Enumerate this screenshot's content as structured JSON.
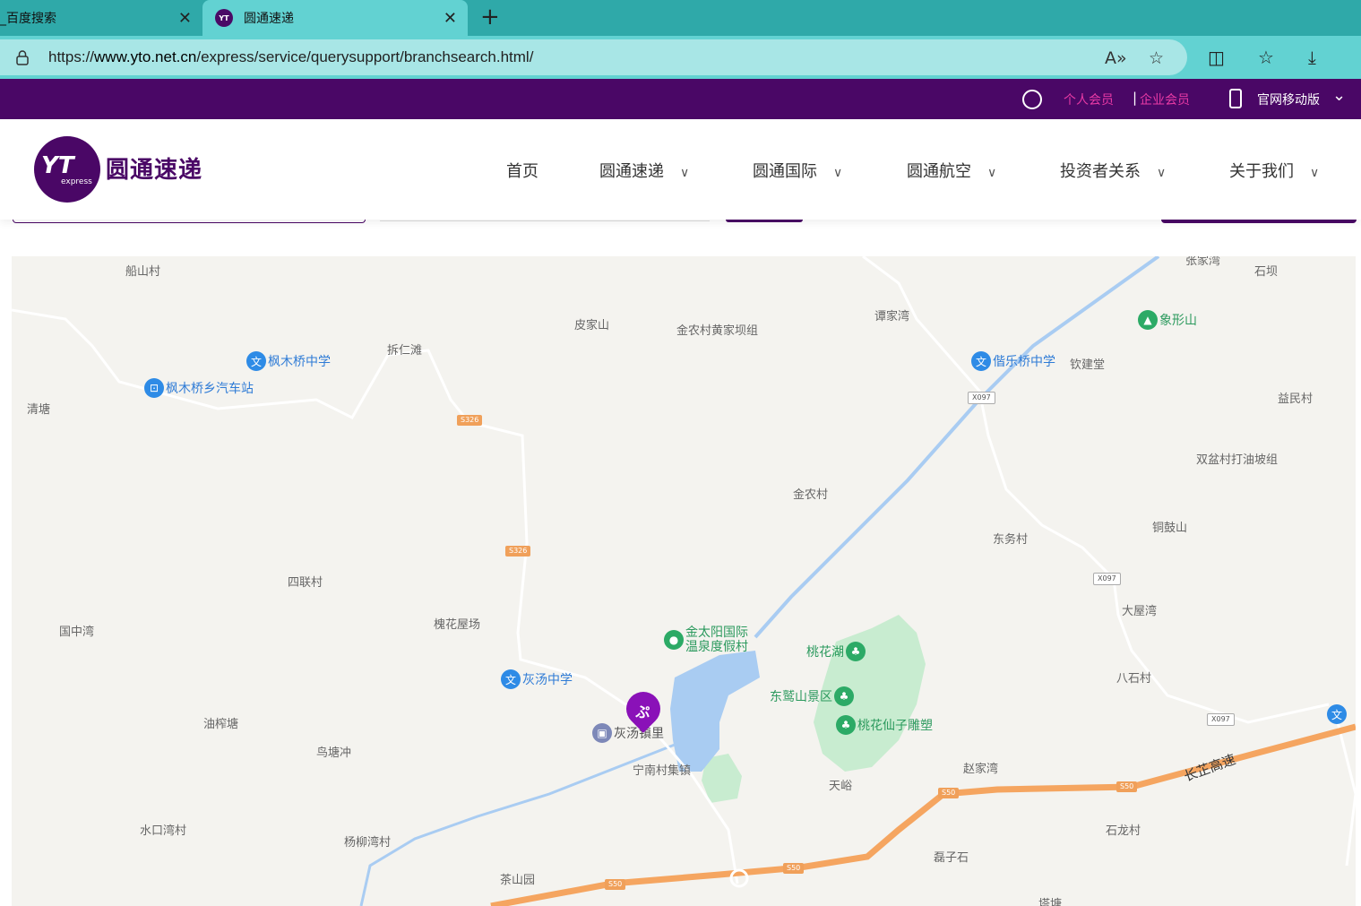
{
  "browser": {
    "tabs": [
      {
        "title": "_百度搜索",
        "active": false
      },
      {
        "title": "圆通速递",
        "active": true
      }
    ],
    "url_prefix": "https://",
    "url_host": "www.yto.net.cn",
    "url_path": "/express/service/querysupport/branchsearch.html/",
    "new_tab_symbol": "+",
    "close_symbol": "✕",
    "colors": {
      "tab_bar": "#2fa9a9",
      "active_tab": "#62d2d2"
    }
  },
  "topbar": {
    "personal": "个人会员",
    "separator": "|",
    "enterprise": "企业会员",
    "mobile": "官网移动版",
    "colors": {
      "bg": "#4a0766",
      "link": "#e83aa5"
    }
  },
  "header": {
    "logo_mark": "YT",
    "logo_sub": "express",
    "logo_text": "圆通速递",
    "nav": [
      {
        "label": "首页",
        "has_menu": false
      },
      {
        "label": "圆通速递",
        "has_menu": true
      },
      {
        "label": "圆通国际",
        "has_menu": true
      },
      {
        "label": "圆通航空",
        "has_menu": true
      },
      {
        "label": "投资者关系",
        "has_menu": true
      },
      {
        "label": "关于我们",
        "has_menu": true
      }
    ]
  },
  "map": {
    "villages": [
      "船山村",
      "皮家山",
      "金农村黄家坝组",
      "谭家湾",
      "张家湾",
      "石坝",
      "拆仁滩",
      "清塘",
      "益民村",
      "双盆村打油坡组",
      "金农村",
      "东务村",
      "铜鼓山",
      "四联村",
      "国中湾",
      "槐花屋场",
      "大屋湾",
      "八石村",
      "油榨塘",
      "鸟塘冲",
      "宁南村集镇",
      "天峪",
      "赵家湾",
      "水口湾村",
      "杨柳湾村",
      "茶山园",
      "石龙村",
      "磊子石",
      "塔塘",
      "钦建堂"
    ],
    "pois": [
      {
        "name": "枫木桥中学",
        "kind": "school"
      },
      {
        "name": "枫木桥乡汽车站",
        "kind": "bus"
      },
      {
        "name": "偕乐桥中学",
        "kind": "school"
      },
      {
        "name": "象形山",
        "kind": "park"
      },
      {
        "name": "金太阳国际温泉度假村",
        "kind": "resort"
      },
      {
        "name": "桃花湖",
        "kind": "park"
      },
      {
        "name": "东鹫山景区",
        "kind": "park"
      },
      {
        "name": "桃花仙子雕塑",
        "kind": "park"
      },
      {
        "name": "灰汤中学",
        "kind": "school"
      },
      {
        "name": "灰汤镇里",
        "kind": "place"
      }
    ],
    "road_codes": [
      "S326",
      "S326",
      "X097",
      "X097",
      "X097",
      "S50",
      "S50",
      "S50",
      "S50"
    ],
    "highway": "长芷高速",
    "colors": {
      "bg": "#f4f3ef",
      "water": "#a9ccf2",
      "green": "#c8ecd0",
      "highway": "#f5a560",
      "marker": "#8a11b8"
    }
  }
}
